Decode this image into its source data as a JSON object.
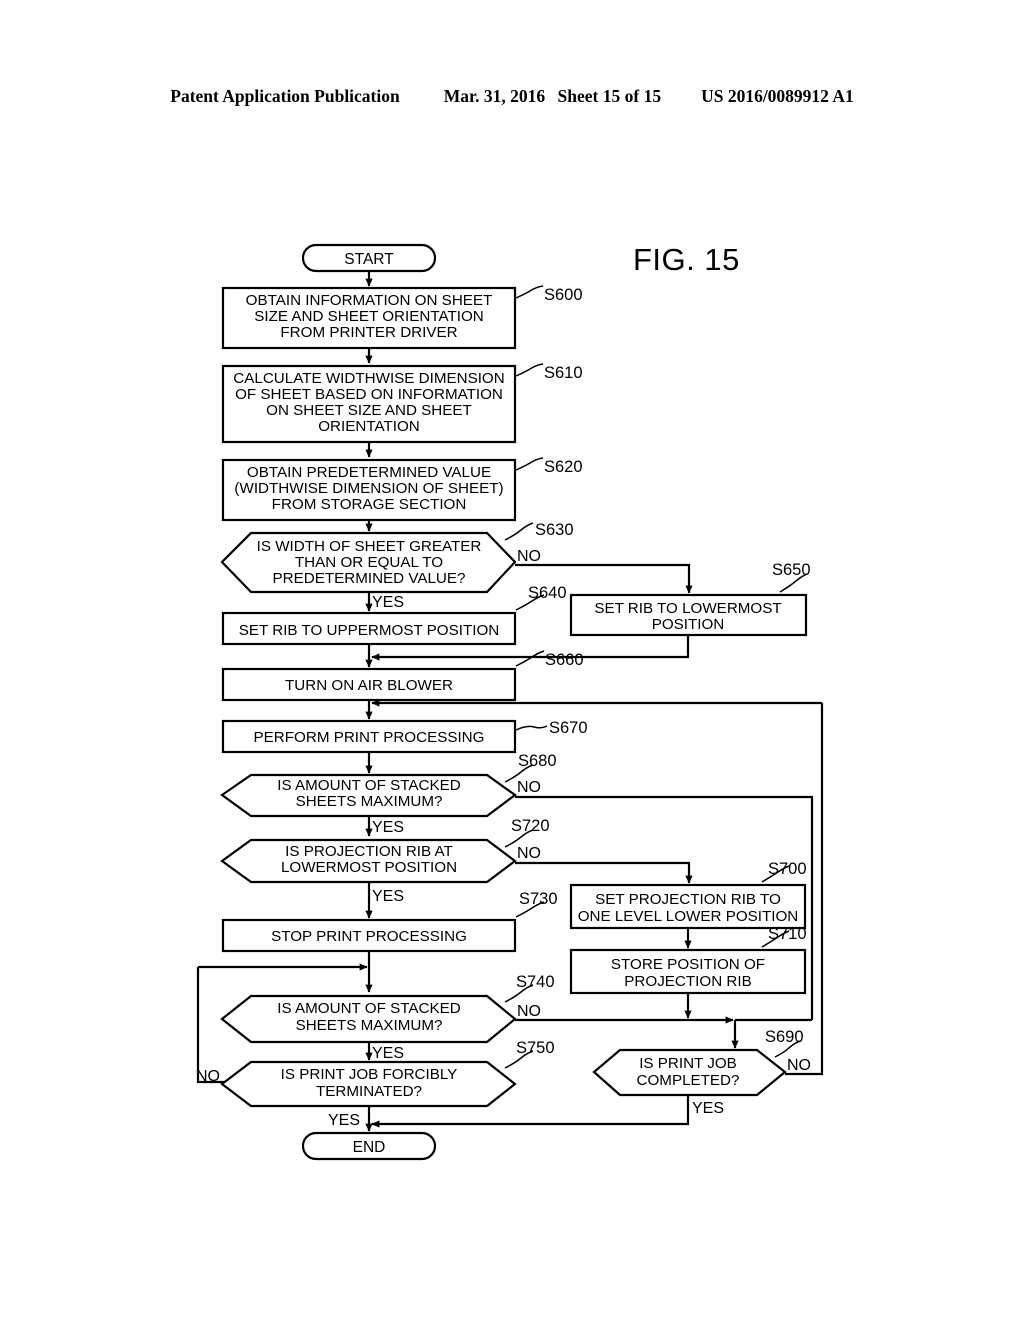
{
  "header": {
    "left": "Patent Application Publication",
    "date": "Mar. 31, 2016",
    "sheet": "Sheet 15 of 15",
    "pubnum": "US 2016/0089912 A1"
  },
  "figure": {
    "label": "FIG. 15"
  },
  "terminals": {
    "start": "START",
    "end": "END"
  },
  "branch_labels": {
    "yes": "YES",
    "no": "NO"
  },
  "nodes": [
    {
      "id": "S600",
      "ref": "S600",
      "type": "process",
      "lines": [
        "OBTAIN INFORMATION ON SHEET",
        "SIZE AND SHEET ORIENTATION",
        "FROM PRINTER DRIVER"
      ]
    },
    {
      "id": "S610",
      "ref": "S610",
      "type": "process",
      "lines": [
        "CALCULATE WIDTHWISE DIMENSION",
        "OF SHEET BASED ON INFORMATION",
        "ON SHEET SIZE AND SHEET",
        "ORIENTATION"
      ]
    },
    {
      "id": "S620",
      "ref": "S620",
      "type": "process",
      "lines": [
        "OBTAIN PREDETERMINED VALUE",
        "(WIDTHWISE DIMENSION OF SHEET)",
        "FROM STORAGE SECTION"
      ]
    },
    {
      "id": "S630",
      "ref": "S630",
      "type": "decision",
      "lines": [
        "IS WIDTH OF SHEET GREATER",
        "THAN OR EQUAL TO",
        "PREDETERMINED VALUE?"
      ]
    },
    {
      "id": "S640",
      "ref": "S640",
      "type": "process",
      "lines": [
        "SET RIB TO UPPERMOST POSITION"
      ]
    },
    {
      "id": "S650",
      "ref": "S650",
      "type": "process",
      "lines": [
        "SET RIB TO LOWERMOST",
        "POSITION"
      ]
    },
    {
      "id": "S660",
      "ref": "S660",
      "type": "process",
      "lines": [
        "TURN ON AIR BLOWER"
      ]
    },
    {
      "id": "S670",
      "ref": "S670",
      "type": "process",
      "lines": [
        "PERFORM PRINT PROCESSING"
      ]
    },
    {
      "id": "S680",
      "ref": "S680",
      "type": "decision",
      "lines": [
        "IS AMOUNT OF STACKED",
        "SHEETS MAXIMUM?"
      ]
    },
    {
      "id": "S720",
      "ref": "S720",
      "type": "decision",
      "lines": [
        "IS PROJECTION RIB AT",
        "LOWERMOST POSITION"
      ]
    },
    {
      "id": "S700",
      "ref": "S700",
      "type": "process",
      "lines": [
        "SET PROJECTION RIB TO",
        "ONE LEVEL LOWER POSITION"
      ]
    },
    {
      "id": "S710",
      "ref": "S710",
      "type": "process",
      "lines": [
        "STORE POSITION OF",
        "PROJECTION RIB"
      ]
    },
    {
      "id": "S730",
      "ref": "S730",
      "type": "process",
      "lines": [
        "STOP PRINT PROCESSING"
      ]
    },
    {
      "id": "S740",
      "ref": "S740",
      "type": "decision",
      "lines": [
        "IS AMOUNT OF STACKED",
        "SHEETS MAXIMUM?"
      ]
    },
    {
      "id": "S750",
      "ref": "S750",
      "type": "decision",
      "lines": [
        "IS PRINT JOB FORCIBLY",
        "TERMINATED?"
      ]
    },
    {
      "id": "S690",
      "ref": "S690",
      "type": "decision",
      "lines": [
        "IS PRINT JOB",
        "COMPLETED?"
      ]
    }
  ],
  "colors": {
    "ink": "#000000",
    "paper": "#ffffff"
  }
}
